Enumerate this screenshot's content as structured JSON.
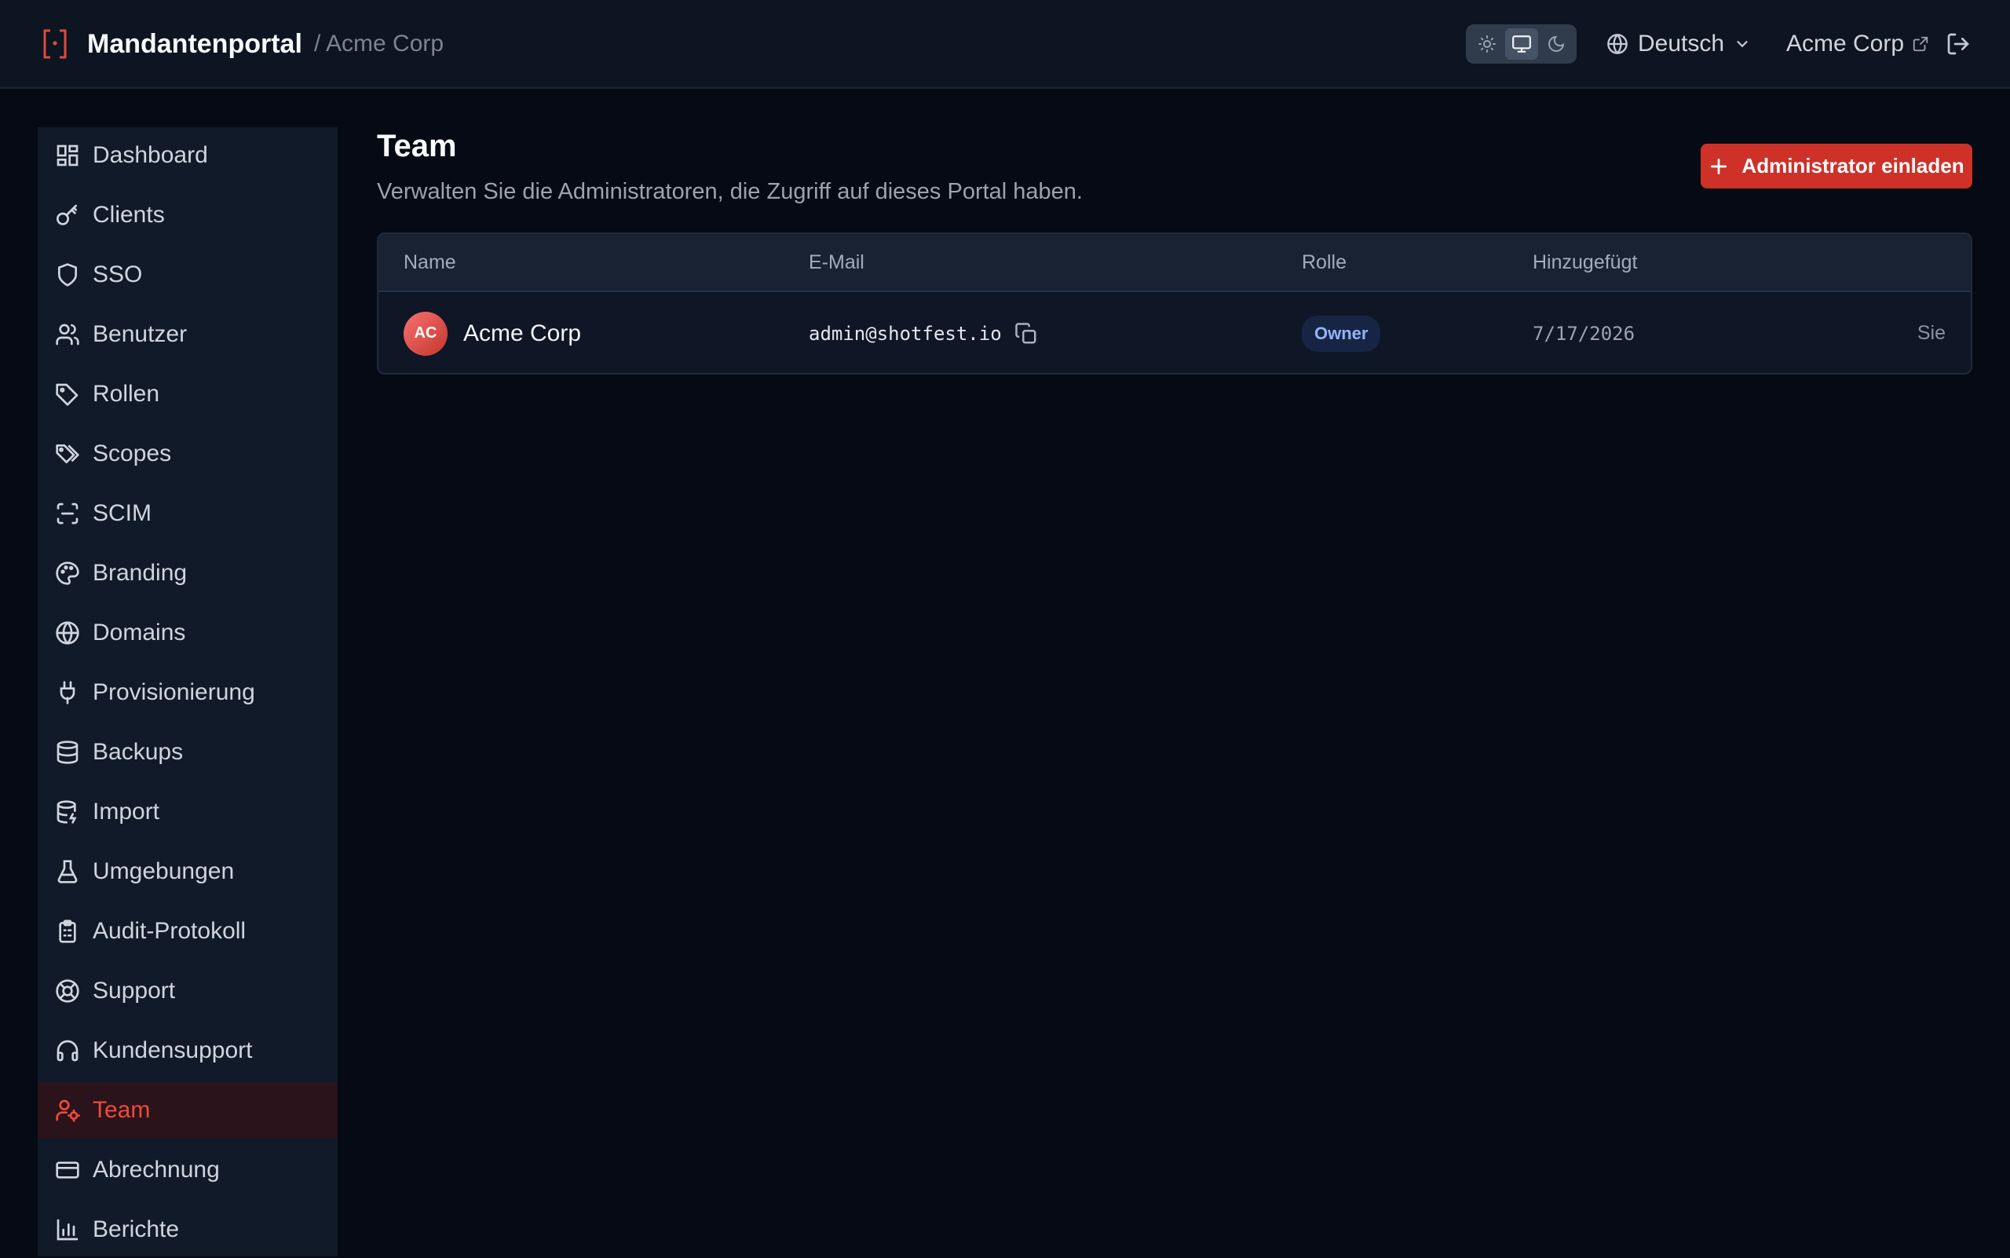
{
  "header": {
    "brand": "Mandantenportal",
    "breadcrumb": "/ Acme Corp",
    "theme_options": [
      "sun-icon",
      "monitor-icon",
      "moon-icon"
    ],
    "theme_selected": "monitor-icon",
    "language": "Deutsch",
    "tenant_link": "Acme Corp"
  },
  "sidebar": {
    "items": [
      {
        "label": "Dashboard",
        "icon": "dashboard-icon"
      },
      {
        "label": "Clients",
        "icon": "key-icon"
      },
      {
        "label": "SSO",
        "icon": "shield-icon"
      },
      {
        "label": "Benutzer",
        "icon": "users-icon"
      },
      {
        "label": "Rollen",
        "icon": "tag-icon"
      },
      {
        "label": "Scopes",
        "icon": "tags-icon"
      },
      {
        "label": "SCIM",
        "icon": "scan-icon"
      },
      {
        "label": "Branding",
        "icon": "palette-icon"
      },
      {
        "label": "Domains",
        "icon": "globe-icon"
      },
      {
        "label": "Provisionierung",
        "icon": "plug-icon"
      },
      {
        "label": "Backups",
        "icon": "database-icon"
      },
      {
        "label": "Import",
        "icon": "database-import-icon"
      },
      {
        "label": "Umgebungen",
        "icon": "flask-icon"
      },
      {
        "label": "Audit-Protokoll",
        "icon": "clipboard-icon"
      },
      {
        "label": "Support",
        "icon": "life-buoy-icon"
      },
      {
        "label": "Kundensupport",
        "icon": "headphones-icon"
      },
      {
        "label": "Team",
        "icon": "user-cog-icon",
        "active": true
      },
      {
        "label": "Abrechnung",
        "icon": "credit-card-icon"
      },
      {
        "label": "Berichte",
        "icon": "bar-chart-icon"
      }
    ]
  },
  "main": {
    "title": "Team",
    "subtitle": "Verwalten Sie die Administratoren, die Zugriff auf dieses Portal haben.",
    "invite_button": "Administrator einladen",
    "table": {
      "columns": [
        "Name",
        "E-Mail",
        "Rolle",
        "Hinzugefügt"
      ],
      "rows": [
        {
          "initials": "AC",
          "name": "Acme Corp",
          "email": "admin@shotfest.io",
          "role": "Owner",
          "added": "7/17/2026",
          "note": "Sie"
        }
      ]
    }
  },
  "colors": {
    "accent": "#cd3128",
    "active_text": "#ef4a3a",
    "background": "#050a14",
    "sidebar": "#111a29",
    "badge_bg": "#172545",
    "badge_text": "#93b4f5"
  }
}
